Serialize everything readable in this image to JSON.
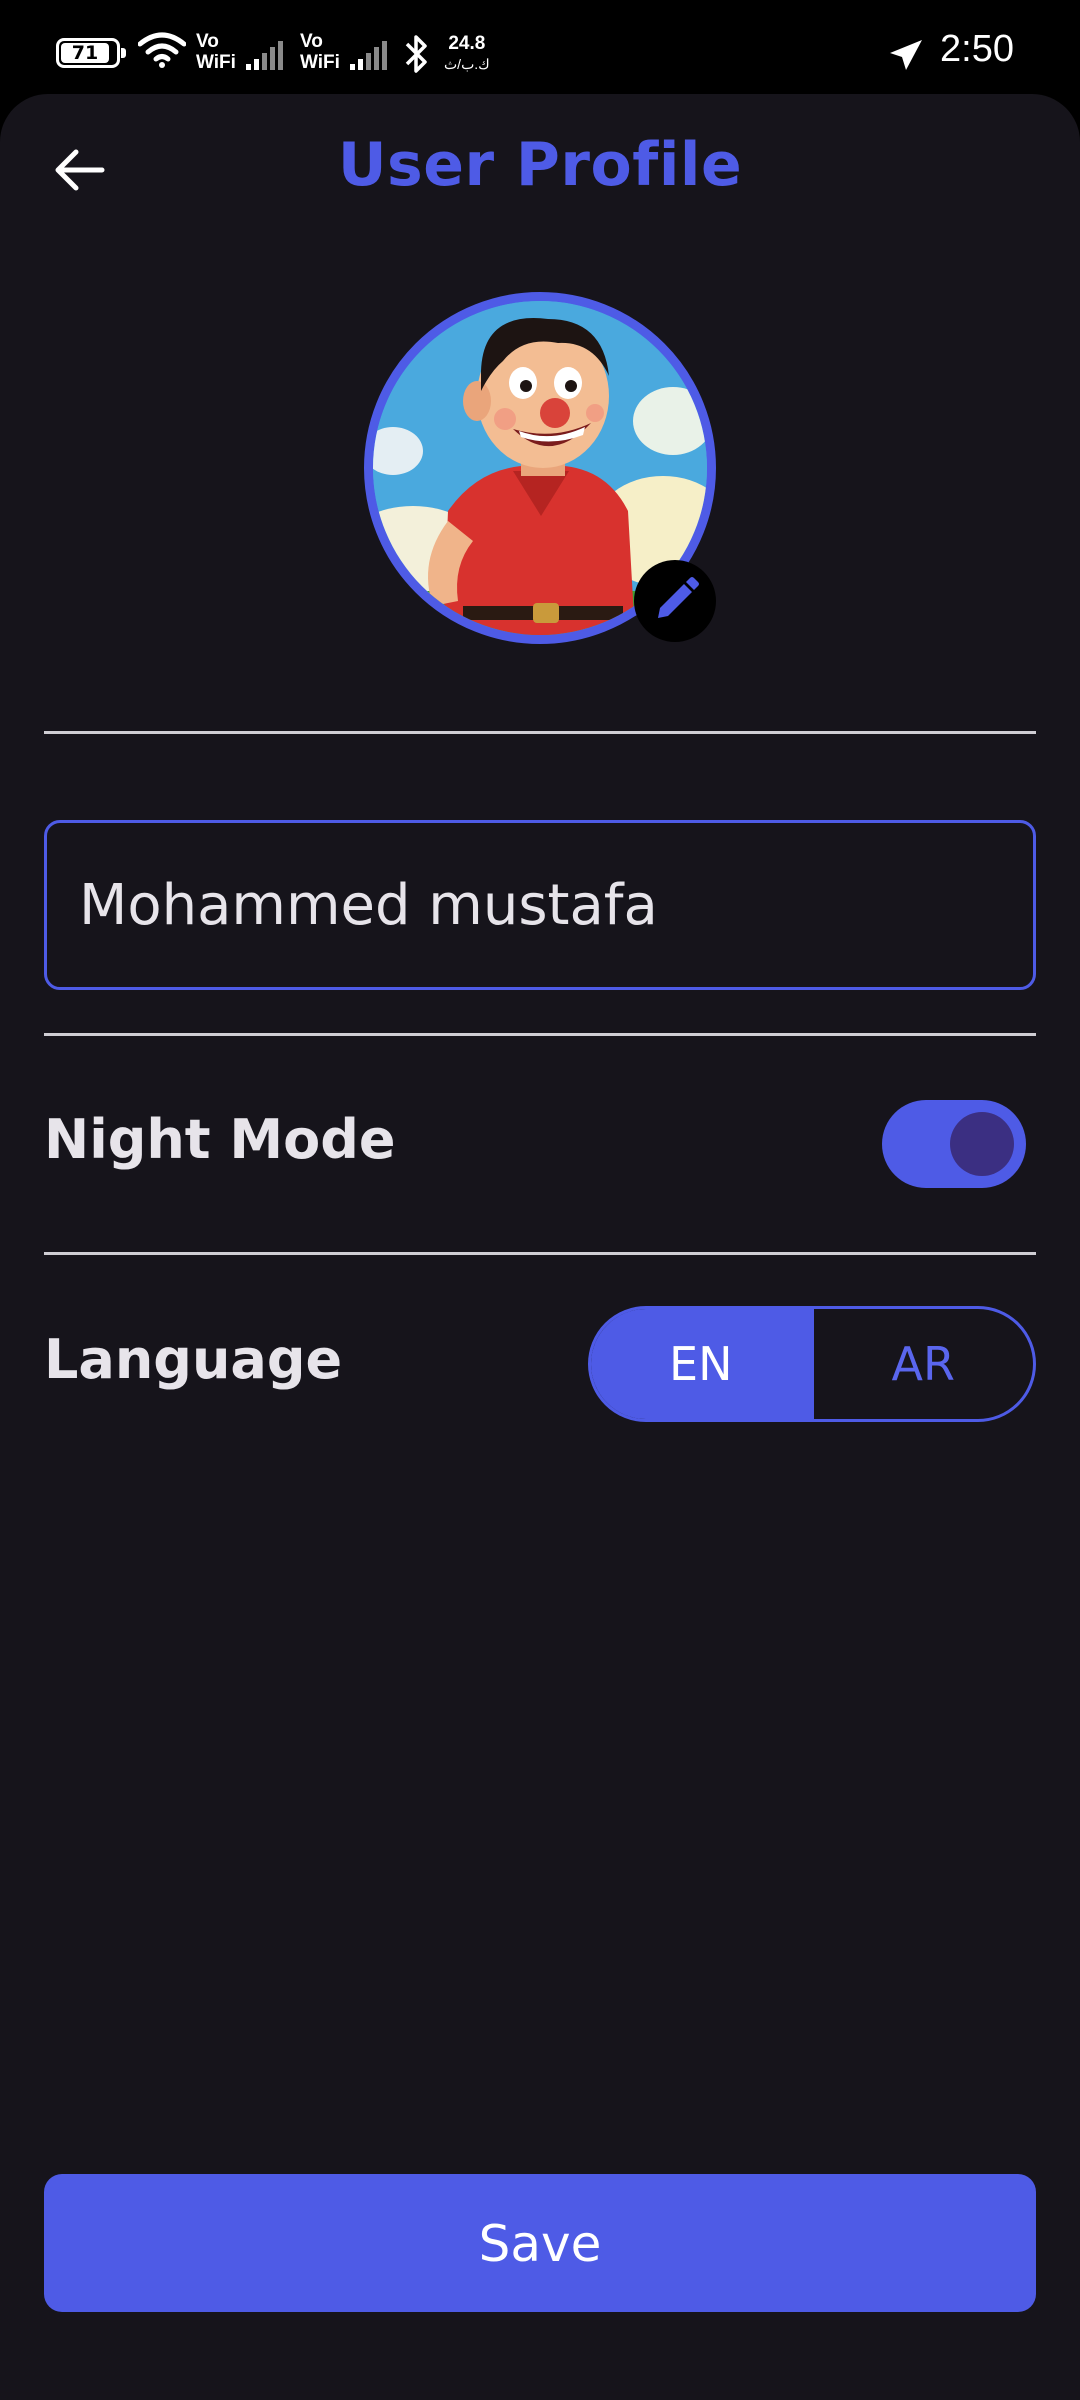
{
  "status_bar": {
    "battery": "71",
    "sim1_vo": "Vo",
    "sim1_wifi": "WiFi",
    "sim2_vo": "Vo",
    "sim2_wifi": "WiFi",
    "net_speed": "24.8",
    "net_unit": "ك.ب/ث",
    "time": "2:50"
  },
  "header": {
    "title": "User Profile"
  },
  "profile": {
    "name_value": "Mohammed mustafa"
  },
  "settings": {
    "night_mode_label": "Night Mode",
    "night_mode_on": true,
    "language_label": "Language",
    "language_options": [
      "EN",
      "AR"
    ],
    "language_selected": "EN"
  },
  "actions": {
    "save_label": "Save"
  },
  "colors": {
    "accent": "#4e5be6",
    "background": "#16141b",
    "text": "#e7e4ea",
    "switch_knob": "#3b2f82"
  }
}
